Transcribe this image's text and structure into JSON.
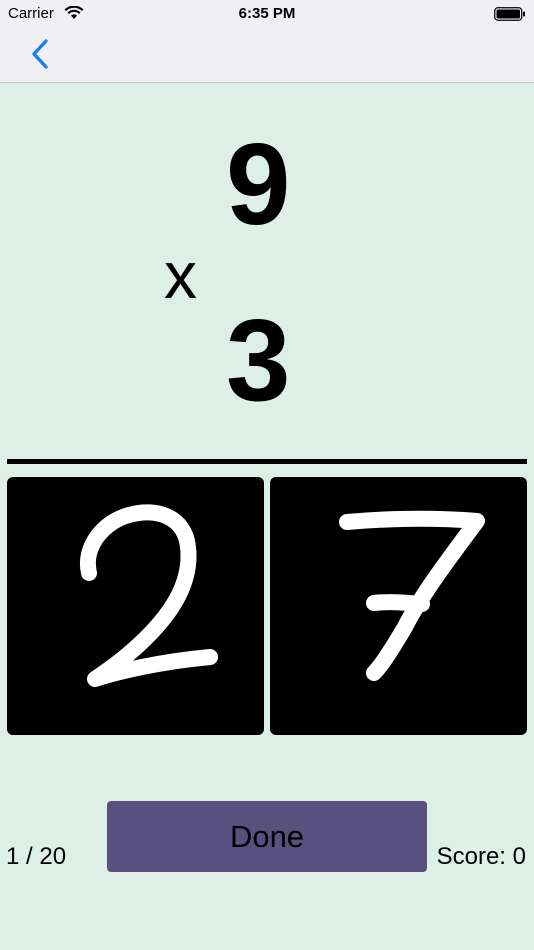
{
  "status_bar": {
    "carrier": "Carrier",
    "time": "6:35 PM",
    "icons": [
      "wifi-icon",
      "battery-icon"
    ]
  },
  "nav_bar": {
    "back_icon": "chevron-left-icon",
    "accent_color": "#1a7cf6"
  },
  "problem": {
    "top_operand": "9",
    "operator": "x",
    "bottom_operand": "3"
  },
  "answer": {
    "digits": [
      "2",
      "7"
    ],
    "pad_color": "#000000",
    "stroke_color": "#ffffff"
  },
  "footer": {
    "progress": "1 / 20",
    "done_label": "Done",
    "score": "Score: 0"
  },
  "colors": {
    "background": "#ddefe7",
    "done_button": "#58507f"
  }
}
